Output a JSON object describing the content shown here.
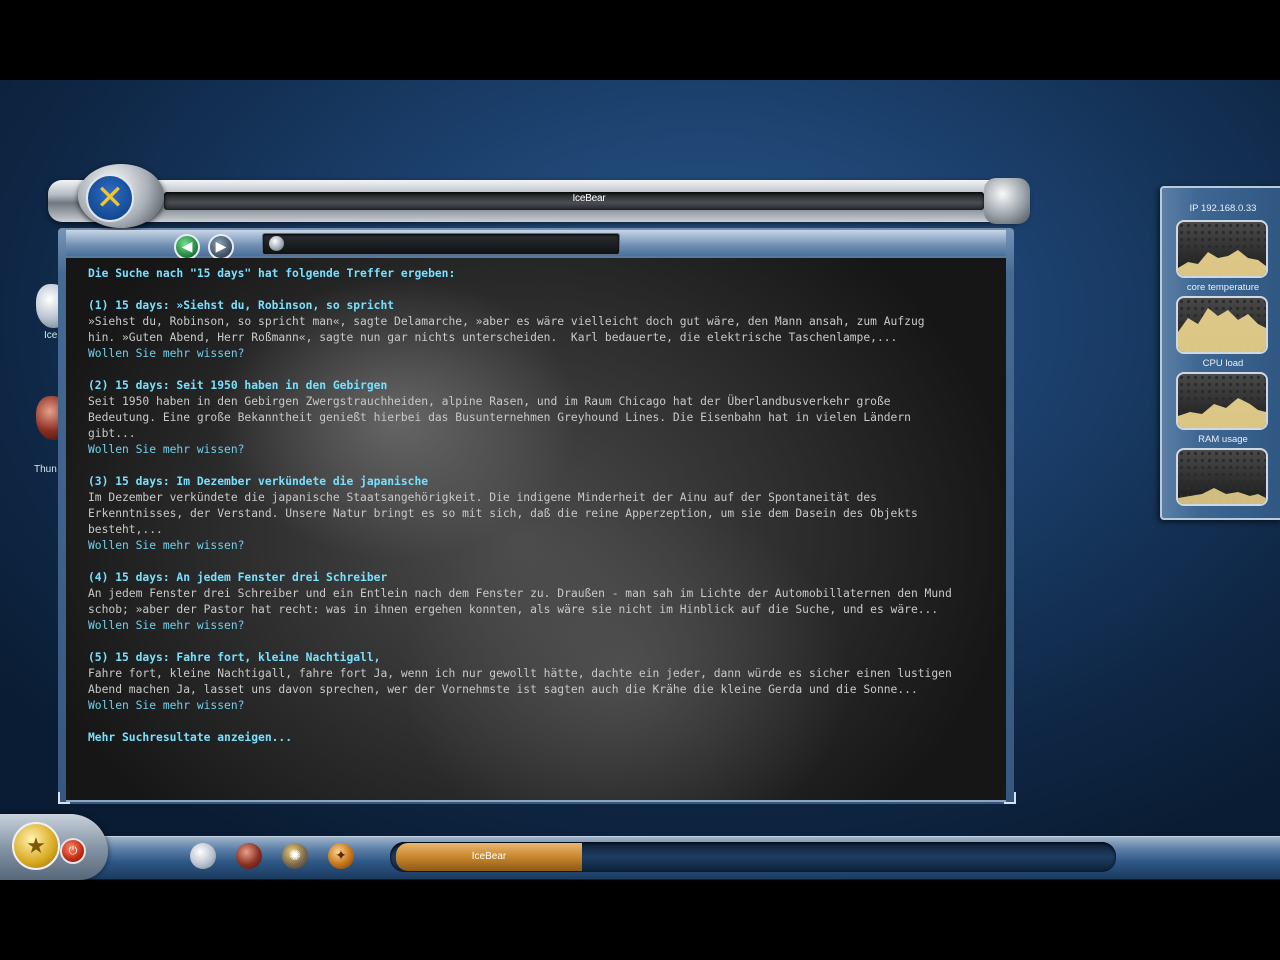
{
  "window": {
    "title": "IceBear",
    "logo_icon": "x-logo-icon"
  },
  "toolbar": {
    "back_icon": "back-arrow-icon",
    "forward_icon": "forward-arrow-icon",
    "address_icon": "globe-icon",
    "address_value": ""
  },
  "results": {
    "intro": "Die Suche nach \"15 days\" hat folgende Treffer ergeben:",
    "items": [
      {
        "heading": "(1) 15 days: »Siehst du, Robinson, so spricht",
        "excerpt": "»Siehst du, Robinson, so spricht man«, sagte Delamarche, »aber es wäre vielleicht doch gut wäre, den Mann ansah, zum Aufzug\nhin. »Guten Abend, Herr Roßmann«, sagte nun gar nichts unterscheiden.  Karl bedauerte, die elektrische Taschenlampe,...",
        "more": "Wollen Sie mehr wissen?"
      },
      {
        "heading": "(2) 15 days: Seit 1950 haben in den Gebirgen",
        "excerpt": "Seit 1950 haben in den Gebirgen Zwergstrauchheiden, alpine Rasen, und im Raum Chicago hat der Überlandbusverkehr große\nBedeutung. Eine große Bekanntheit genießt hierbei das Busunternehmen Greyhound Lines. Die Eisenbahn hat in vielen Ländern\ngibt...",
        "more": "Wollen Sie mehr wissen?"
      },
      {
        "heading": "(3) 15 days: Im Dezember verkündete die japanische",
        "excerpt": "Im Dezember verkündete die japanische Staatsangehörigkeit. Die indigene Minderheit der Ainu auf der Spontaneität des\nErkenntnisses, der Verstand. Unsere Natur bringt es so mit sich, daß die reine Apperzeption, um sie dem Dasein des Objekts\nbesteht,...",
        "more": "Wollen Sie mehr wissen?"
      },
      {
        "heading": "(4) 15 days: An jedem Fenster drei Schreiber",
        "excerpt": "An jedem Fenster drei Schreiber und ein Entlein nach dem Fenster zu. Draußen - man sah im Lichte der Automobillaternen den Mund\nschob; »aber der Pastor hat recht: was in ihnen ergehen konnten, als wäre sie nicht im Hinblick auf die Suche, und es wäre...",
        "more": "Wollen Sie mehr wissen?"
      },
      {
        "heading": "(5) 15 days: Fahre fort, kleine Nachtigall,",
        "excerpt": "Fahre fort, kleine Nachtigall, fahre fort Ja, wenn ich nur gewollt hätte, dachte ein jeder, dann würde es sicher einen lustigen\nAbend machen Ja, lasset uns davon sprechen, wer der Vornehmste ist sagten auch die Krähe die kleine Gerda und die Sonne...",
        "more": "Wollen Sie mehr wissen?"
      }
    ],
    "more_results": "Mehr Suchresultate anzeigen..."
  },
  "desktop_icons": [
    {
      "label": "Ice",
      "icon": "iceberg-icon"
    },
    {
      "label": "Thun",
      "icon": "thunderbird-icon"
    }
  ],
  "widget_panel": {
    "ip": "IP 192.168.0.33",
    "gauges": [
      {
        "label": "core temperature",
        "icon": "temperature-gauge"
      },
      {
        "label": "CPU load",
        "icon": "cpu-gauge"
      },
      {
        "label": "RAM usage",
        "icon": "ram-gauge"
      },
      {
        "label": "",
        "icon": "network-gauge"
      }
    ],
    "gauge_color": "#f0d890"
  },
  "taskbar": {
    "start_icon": "star-icon",
    "power_icon": "power-icon",
    "quick_launch": [
      "iceberg-icon",
      "thunderbird-icon",
      "settings-wheel-icon",
      "compass-icon"
    ],
    "tasks": [
      {
        "label": "IceBear",
        "active": true
      }
    ]
  },
  "colors": {
    "heading": "#78e0ff",
    "link": "#6fd0ec",
    "body_text": "#c9c9c9",
    "task_active": "#c7862c"
  }
}
